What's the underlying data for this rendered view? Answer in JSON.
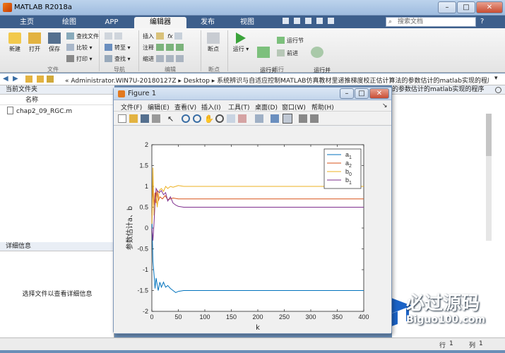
{
  "app": {
    "title": "MATLAB R2018a"
  },
  "tabs": [
    {
      "label": "主页"
    },
    {
      "label": "绘图"
    },
    {
      "label": "APP"
    },
    {
      "label": "编辑器"
    },
    {
      "label": "发布"
    },
    {
      "label": "视图"
    }
  ],
  "search": {
    "placeholder": "搜索文档"
  },
  "ribbon": {
    "new": "新建",
    "open": "打开",
    "save": "保存",
    "find_files": "查找文件",
    "compare": "比较",
    "print": "打印",
    "group_file": "文件",
    "goto": "转至",
    "find": "查找",
    "group_nav": "导航",
    "insert": "插入",
    "fx": "fx",
    "comment": "注释",
    "indent": "缩进",
    "group_edit": "编辑",
    "breakpoints": "断点",
    "group_bp": "断点",
    "run": "运行",
    "run_advance": "运行并\n前进",
    "run_section": "运行节",
    "advance": "前进",
    "run_time": "运行并\n计时",
    "group_run": "运行"
  },
  "address": {
    "path": "« Administrator.WIN7U-20180127Z  ▸  Desktop  ▸  系统辨识与自适应控制MATLAB仿真教材里递推梯度校正估计算法的参数估计的matlab实现的程序"
  },
  "left_panel": {
    "header": "当前文件夹",
    "col_name": "名称",
    "file": "chap2_09_RGC.m",
    "details_header": "详细信息",
    "details_hint": "选择文件以查看详细信息"
  },
  "right_fragment": "的参数估计的matlab实现的程序",
  "status": {
    "row_label": "行",
    "row": "1",
    "col_label": "列",
    "col": "1"
  },
  "figure": {
    "title": "Figure 1",
    "menu": [
      "文件(F)",
      "编辑(E)",
      "查看(V)",
      "插入(I)",
      "工具(T)",
      "桌面(D)",
      "窗口(W)",
      "帮助(H)"
    ]
  },
  "watermark": {
    "brand": "必过源码",
    "url": "Biguo100.com"
  },
  "chart_data": {
    "type": "line",
    "xlabel": "k",
    "ylabel": "参数估计a、b",
    "xlim": [
      0,
      400
    ],
    "ylim": [
      -2,
      2
    ],
    "xticks": [
      0,
      50,
      100,
      150,
      200,
      250,
      300,
      350,
      400
    ],
    "yticks": [
      -2,
      -1.5,
      -1,
      -0.5,
      0,
      0.5,
      1,
      1.5,
      2
    ],
    "legend_position": "top-right",
    "series": [
      {
        "name": "a1",
        "color": "#0072BD",
        "x": [
          0,
          2,
          4,
          6,
          8,
          10,
          12,
          15,
          18,
          22,
          26,
          30,
          35,
          40,
          45,
          50,
          60,
          400
        ],
        "y": [
          0.3,
          -0.8,
          -1.1,
          -1.45,
          -1.2,
          -1.35,
          -1.5,
          -1.3,
          -1.42,
          -1.3,
          -1.42,
          -1.38,
          -1.45,
          -1.5,
          -1.55,
          -1.52,
          -1.5,
          -1.5
        ]
      },
      {
        "name": "a2",
        "color": "#D95319",
        "x": [
          0,
          2,
          4,
          6,
          8,
          10,
          12,
          15,
          20,
          25,
          30,
          40,
          50,
          60,
          400
        ],
        "y": [
          0.1,
          1.0,
          0.55,
          0.85,
          0.6,
          0.9,
          0.65,
          0.75,
          0.7,
          0.78,
          0.68,
          0.72,
          0.7,
          0.7,
          0.7
        ]
      },
      {
        "name": "b0",
        "color": "#EDB120",
        "x": [
          0,
          2,
          4,
          6,
          8,
          10,
          14,
          18,
          22,
          26,
          30,
          35,
          40,
          45,
          50,
          60,
          400
        ],
        "y": [
          0.1,
          1.45,
          0.3,
          0.6,
          0.85,
          0.5,
          0.9,
          0.95,
          0.88,
          1.0,
          0.95,
          1.0,
          0.98,
          1.0,
          1.02,
          1.0,
          1.0
        ]
      },
      {
        "name": "b1",
        "color": "#7E2F8E",
        "x": [
          0,
          2,
          4,
          6,
          8,
          10,
          14,
          18,
          22,
          26,
          30,
          35,
          40,
          45,
          50,
          60,
          400
        ],
        "y": [
          0.0,
          -0.3,
          0.1,
          0.6,
          0.95,
          0.9,
          0.85,
          0.9,
          0.8,
          0.85,
          0.65,
          0.75,
          0.6,
          0.55,
          0.52,
          0.5,
          0.5
        ]
      }
    ]
  }
}
